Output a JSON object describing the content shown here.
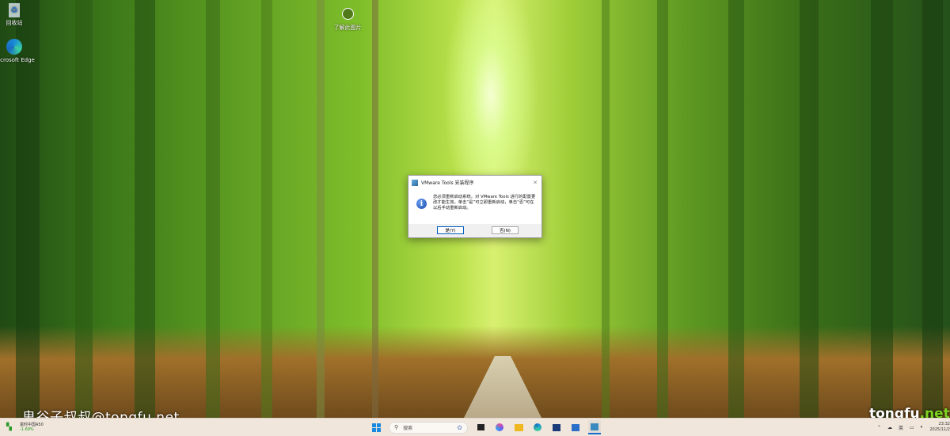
{
  "desktop": {
    "icons": [
      {
        "label": "回收站",
        "icon": "recycle-bin-icon"
      },
      {
        "label": "Microsoft Edge",
        "icon": "edge-icon"
      },
      {
        "label": "了解此图片",
        "icon": "learn-about-picture-icon"
      }
    ],
    "watermark": "鬼谷子叔叔@tongfu.net",
    "watermark_logo": {
      "main": "tongfu",
      "suffix": ".net"
    }
  },
  "dialog": {
    "title": "VMware Tools 安装程序",
    "message": "您必须重新启动系统，对 VMware Tools 进行的配置更改才能生效。单击“是”可立即重新启动，单击“否”可在以后手动重新启动。",
    "yes_label": "是(Y)",
    "no_label": "否(N)",
    "close_label": "✕"
  },
  "taskbar": {
    "widget": {
      "name": "富时中国A50",
      "change": "-1.69%"
    },
    "search_placeholder": "搜索",
    "apps": [
      "task-view",
      "copilot",
      "file-explorer",
      "edge",
      "microsoft-store",
      "outlook",
      "vmware-tools"
    ],
    "tray": {
      "ime": "英",
      "time": "23:32",
      "date": "2025/11/2"
    }
  },
  "colors": {
    "accent": "#0060c0",
    "stock_down": "#1a9a1a"
  }
}
